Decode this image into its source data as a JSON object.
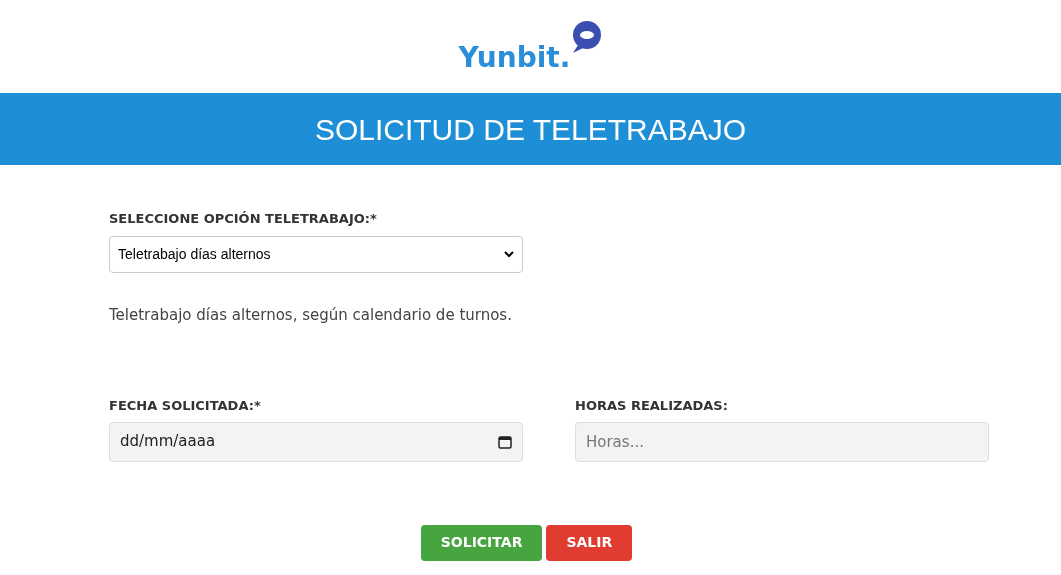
{
  "logo": {
    "text": "Yunbit."
  },
  "header": {
    "title": "SOLICITUD DE TELETRABAJO"
  },
  "option_select": {
    "label": "SELECCIONE OPCIÓN TELETRABAJO:*",
    "value": "Teletrabajo días alternos"
  },
  "description": "Teletrabajo días alternos, según calendario de turnos.",
  "date_field": {
    "label": "FECHA SOLICITADA:*",
    "placeholder": "dd/mm/aaaa"
  },
  "hours_field": {
    "label": "HORAS REALIZADAS:",
    "placeholder": "Horas..."
  },
  "buttons": [
    {
      "label": "SOLICITAR",
      "kind": "submit"
    },
    {
      "label": "SALIR",
      "kind": "exit"
    }
  ]
}
